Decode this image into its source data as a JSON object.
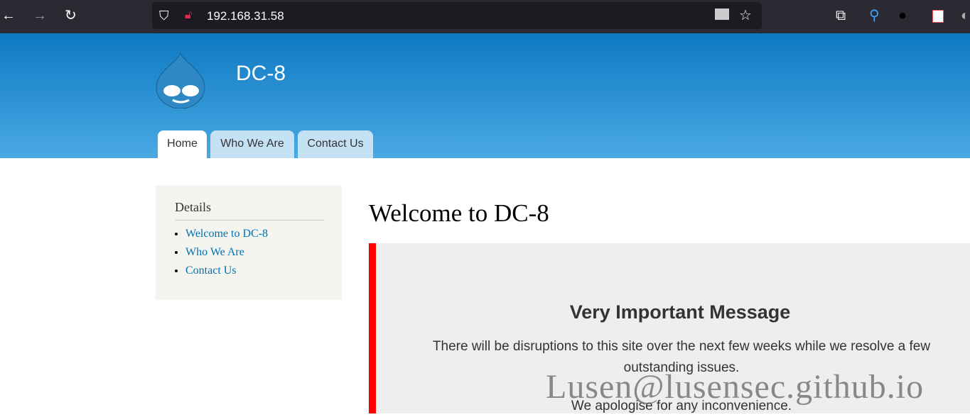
{
  "browser": {
    "url": "192.168.31.58",
    "icons": [
      "back-icon",
      "forward-icon",
      "reload-icon",
      "shield-icon",
      "insecure-lock-icon",
      "reader-icon",
      "bookmark-star-icon",
      "extensions-icon",
      "pin-icon",
      "hat-icon",
      "extension-icon"
    ]
  },
  "site": {
    "name": "DC-8",
    "tabs": [
      "Home",
      "Who We Are",
      "Contact Us"
    ],
    "active_tab": "Home"
  },
  "sidebar": {
    "title": "Details",
    "links": [
      "Welcome to DC-8",
      "Who We Are",
      "Contact Us"
    ]
  },
  "main": {
    "title": "Welcome to DC-8",
    "message": {
      "heading": "Very Important Message",
      "line1": "There will be disruptions to this site over the next few weeks while we resolve a few outstanding issues.",
      "line2": "We apologise for any inconvenience."
    },
    "accent": "#ff0000"
  },
  "watermark": "Lusen@lusensec.github.io"
}
